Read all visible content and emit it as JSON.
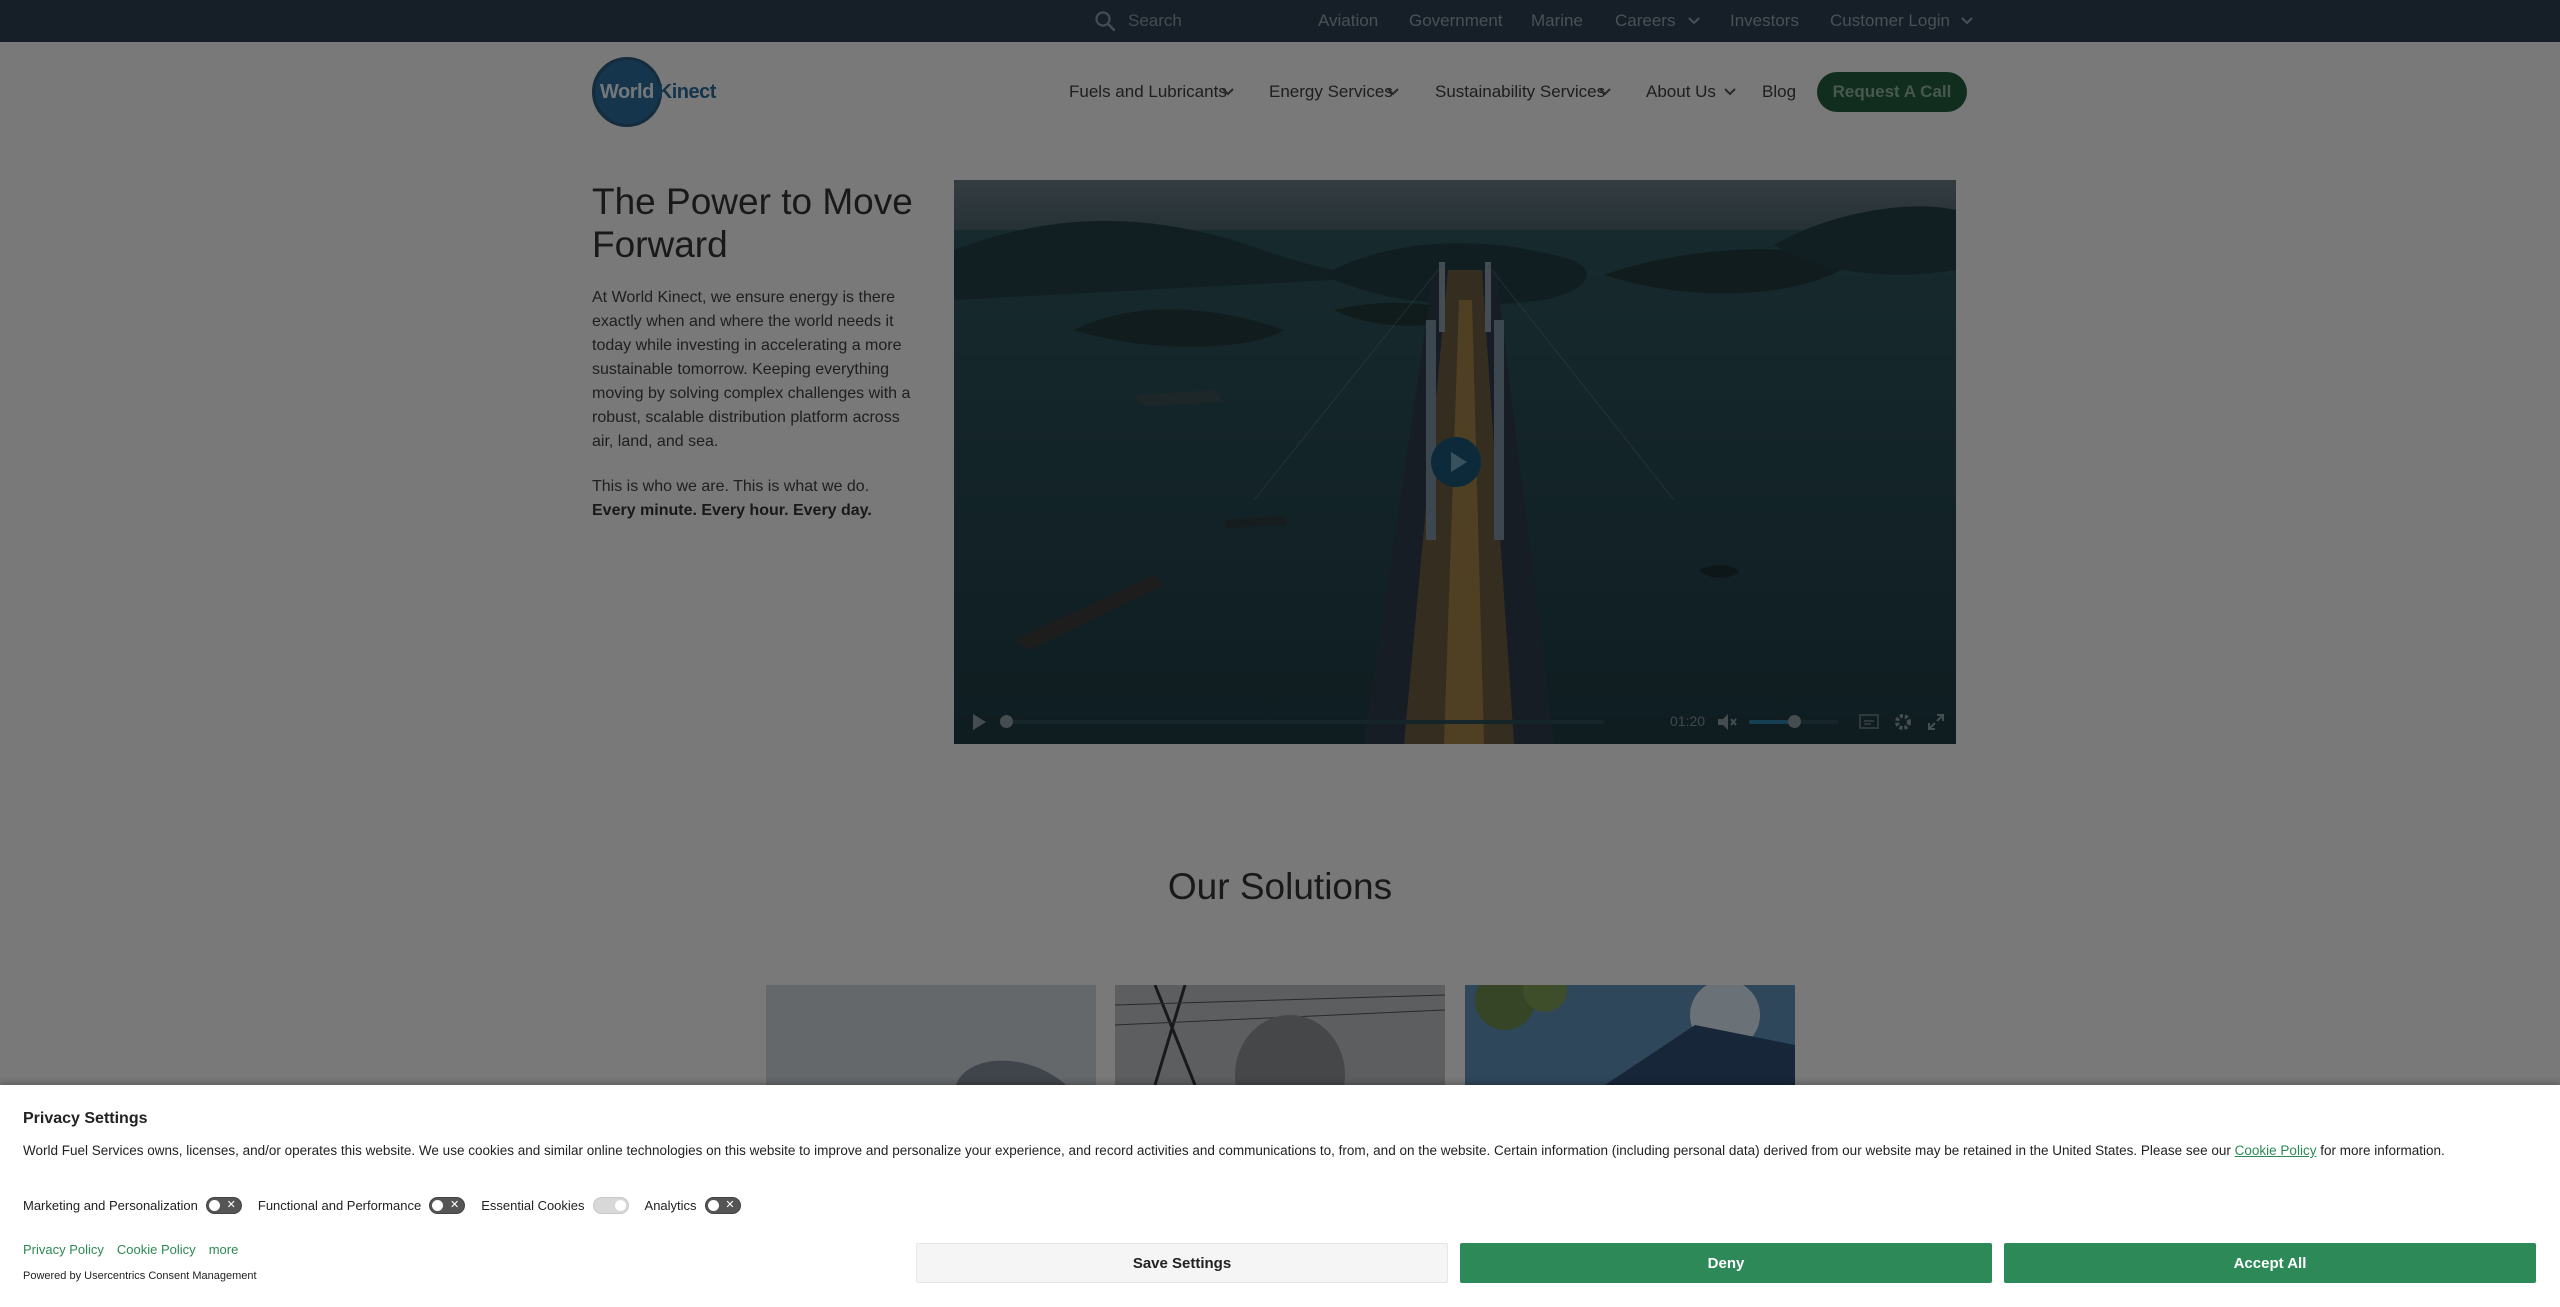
{
  "topbar": {
    "search_placeholder": "Search",
    "links": [
      "Aviation",
      "Government",
      "Marine",
      "Careers",
      "Investors",
      "Customer Login"
    ]
  },
  "header": {
    "logo_text_a": "World",
    "logo_text_b": "Kinect",
    "nav": [
      "Fuels and Lubricants",
      "Energy Services",
      "Sustainability Services",
      "About Us",
      "Blog"
    ],
    "cta_label": "Request A Call"
  },
  "hero": {
    "title": "The Power to Move Forward",
    "paragraph": "At World Kinect, we ensure energy is there exactly when and where the world needs it today while investing in accelerating a more sustainable tomorrow. Keeping everything moving by solving complex challenges with a robust, scalable distribution platform across air, land, and sea.",
    "tagline": "This is who we are. This is what we do.",
    "tagline_bold": "Every minute. Every hour. Every day."
  },
  "video": {
    "duration": "01:20",
    "progress_fraction": 0.0,
    "volume_fraction": 0.5
  },
  "solutions": {
    "title": "Our Solutions"
  },
  "consent": {
    "title": "Privacy Settings",
    "text_before_link": "World Fuel Services owns, licenses, and/or operates this website. We use cookies and similar online technologies on this website to improve and personalize your experience, and record activities and communications to, from, and on the website. Certain information (including personal data) derived from our website may be retained in the United States. Please see our ",
    "link_text": "Cookie Policy",
    "text_after_link": " for more information.",
    "toggles": [
      "Marketing and Personalization",
      "Functional and Performance",
      "Essential Cookies",
      "Analytics"
    ],
    "links": [
      "Privacy Policy",
      "Cookie Policy",
      "more"
    ],
    "powered_by": "Powered by Usercentrics Consent Management",
    "buttons": {
      "save": "Save Settings",
      "deny": "Deny",
      "accept": "Accept All"
    }
  },
  "colors": {
    "topbar": "#2c3e50",
    "brand_green": "#2d8a58",
    "brand_blue": "#2a6a9a"
  }
}
